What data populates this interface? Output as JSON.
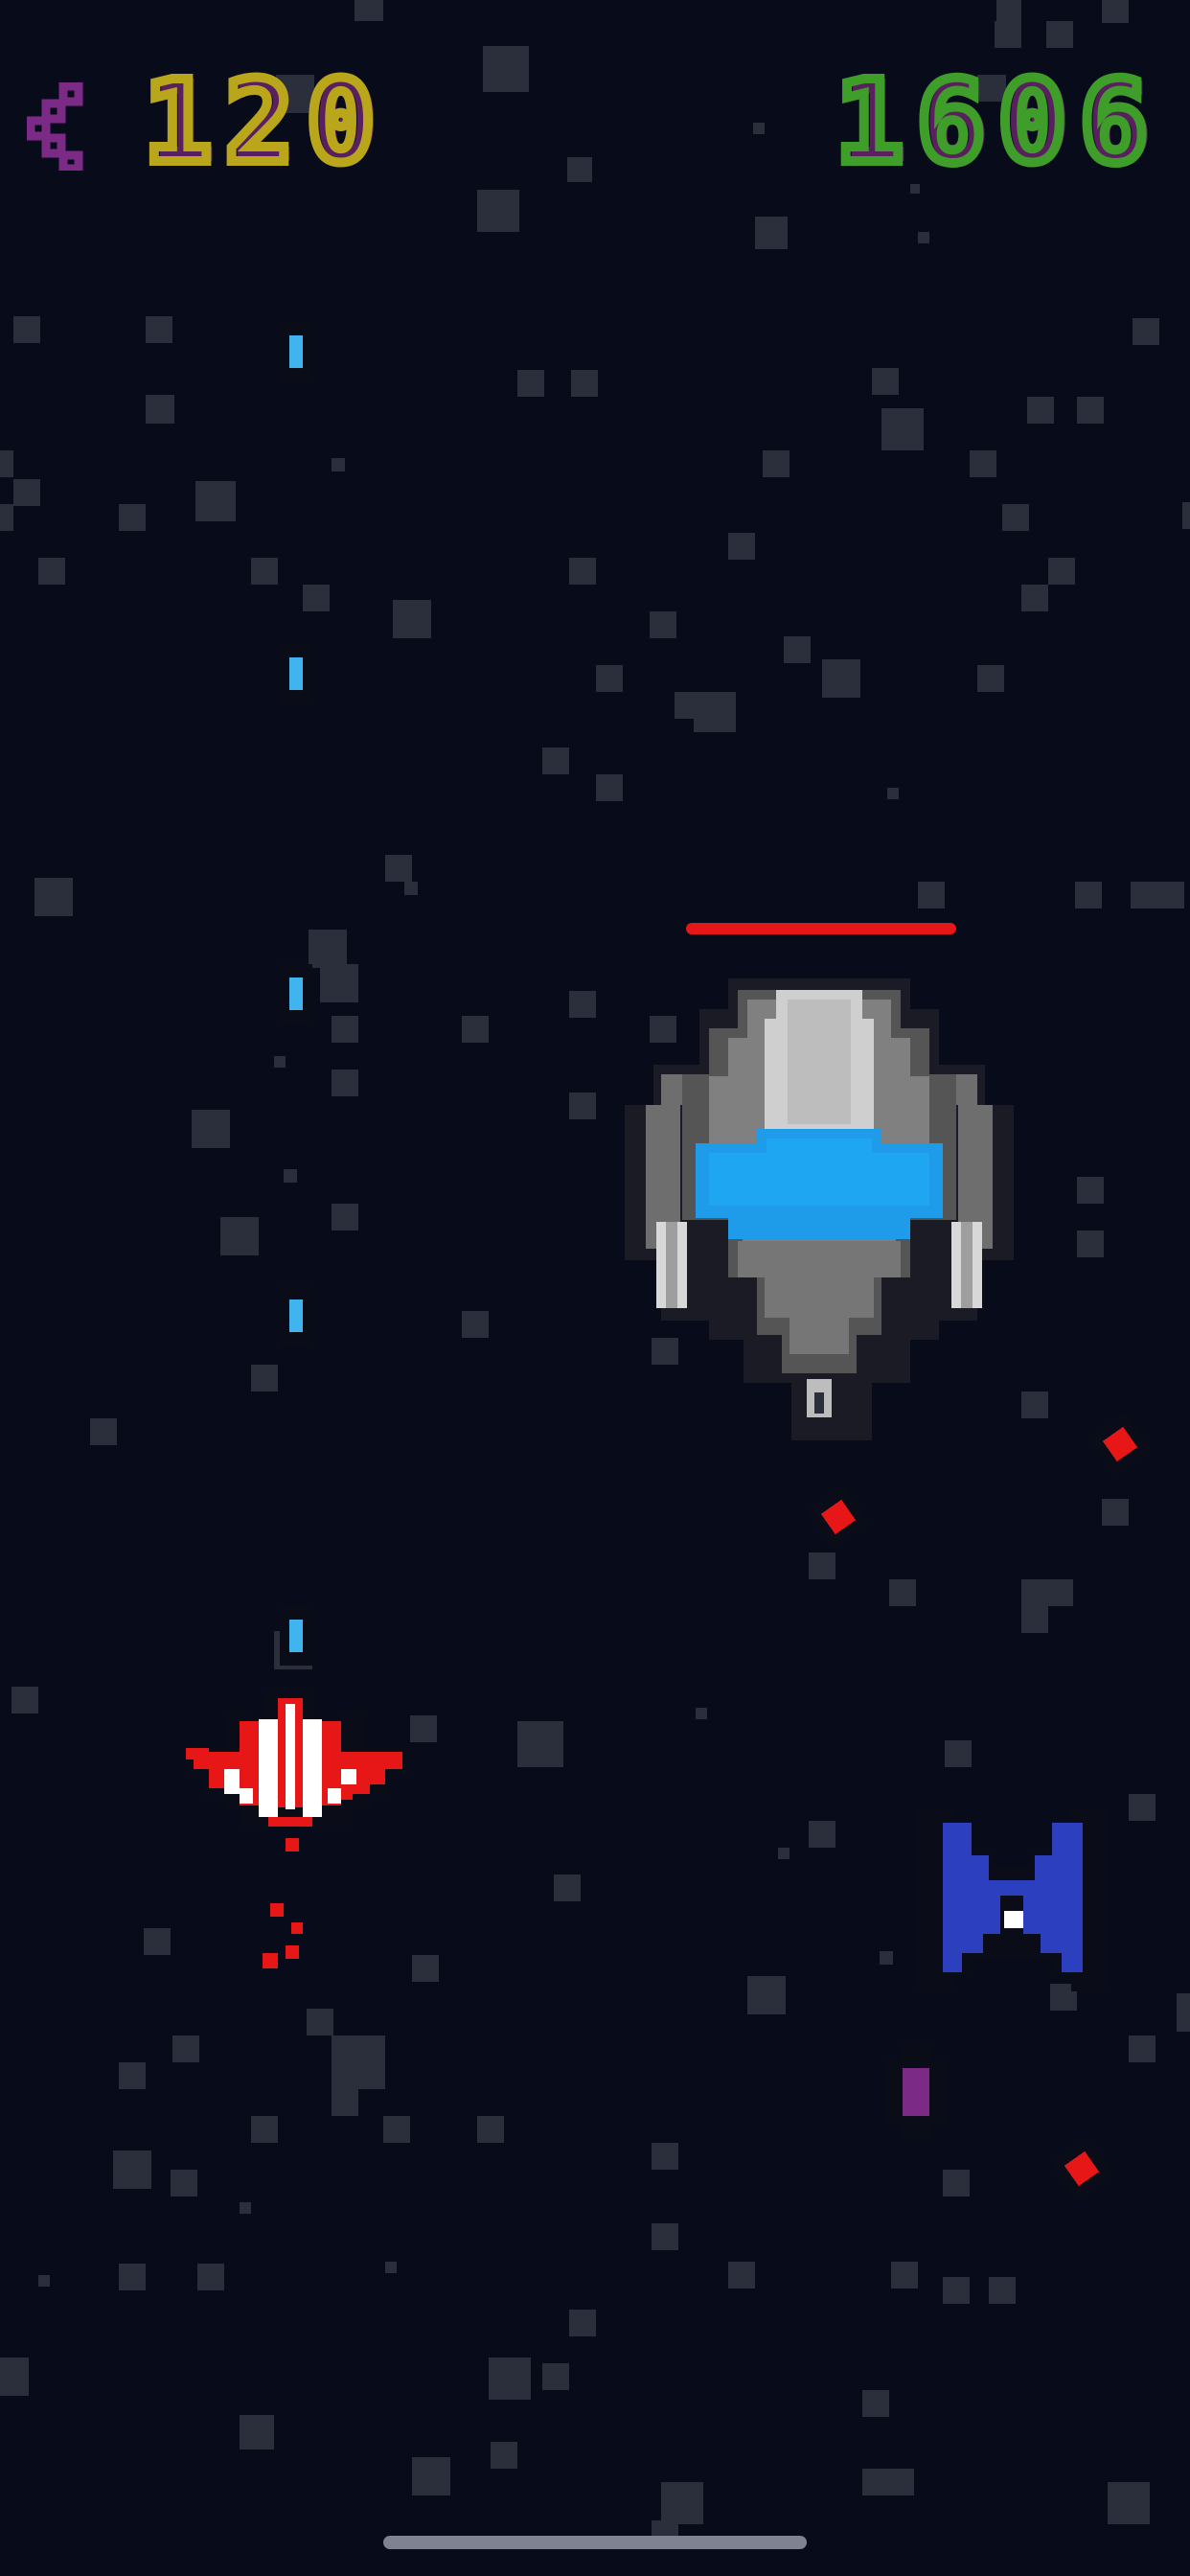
{
  "hud": {
    "back_icon": "chevron-left-icon",
    "timer": "120",
    "score": "1606",
    "timer_color": "#b9a61b",
    "score_color": "#3f9d2a",
    "outline_color": "#5a1f5e",
    "back_color": "#7b2a86"
  },
  "boss": {
    "icon": "boss-mothership-icon",
    "health_fraction": 1.0,
    "health_color": "#e81717",
    "hull_color": "#8a8a8a",
    "dome_color": "#1e9cea"
  },
  "player": {
    "icon": "player-red-fighter-icon",
    "color": "#e81717",
    "stripe_color": "#ffffff"
  },
  "enemies": [
    {
      "type": "blue-interceptor",
      "icon": "blue-interceptor-icon",
      "color": "#2b3fbf"
    }
  ],
  "projectiles": {
    "player_laser_color": "#3fb4ee",
    "enemy_mine_color": "#e81717",
    "purple_shot_color": "#7b2a86"
  },
  "colors": {
    "background": "#080c1a",
    "star": "#2b2f3b"
  }
}
